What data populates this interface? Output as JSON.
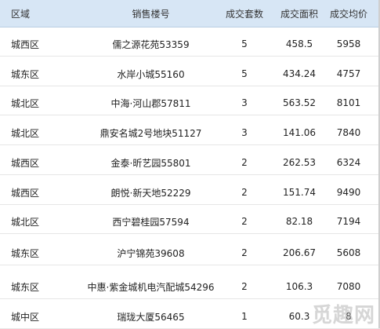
{
  "table": {
    "headers": {
      "area": "区域",
      "project": "销售楼号",
      "units": "成交套数",
      "sqm": "成交面积",
      "price": "成交均价"
    },
    "rows": [
      {
        "area": "城西区",
        "project": "儒之源花苑53359",
        "units": "5",
        "sqm": "458.5",
        "price": "5958"
      },
      {
        "area": "城东区",
        "project": "水岸小城55160",
        "units": "5",
        "sqm": "434.24",
        "price": "4757"
      },
      {
        "area": "城北区",
        "project": "中海·河山郡57811",
        "units": "3",
        "sqm": "563.52",
        "price": "8101"
      },
      {
        "area": "城北区",
        "project": "鼎安名城2号地块51127",
        "units": "3",
        "sqm": "141.06",
        "price": "7840"
      },
      {
        "area": "城西区",
        "project": "金泰·昕艺园55801",
        "units": "2",
        "sqm": "262.53",
        "price": "6324"
      },
      {
        "area": "城西区",
        "project": "朗悦·新天地52229",
        "units": "2",
        "sqm": "151.74",
        "price": "9490"
      },
      {
        "area": "城北区",
        "project": "西宁碧桂园57594",
        "units": "2",
        "sqm": "82.18",
        "price": "7194"
      },
      {
        "area": "城东区",
        "project": "沪宁锦苑39608",
        "units": "2",
        "sqm": "206.67",
        "price": "5608"
      },
      {
        "area": "城东区",
        "project": "中惠·紫金城机电汽配城54296",
        "units": "2",
        "sqm": "106.3",
        "price": "7080"
      },
      {
        "area": "城中区",
        "project": "瑞珑大厦56465",
        "units": "1",
        "sqm": "60.3",
        "price": "8"
      }
    ]
  },
  "watermark": {
    "text": "觅趣网"
  }
}
